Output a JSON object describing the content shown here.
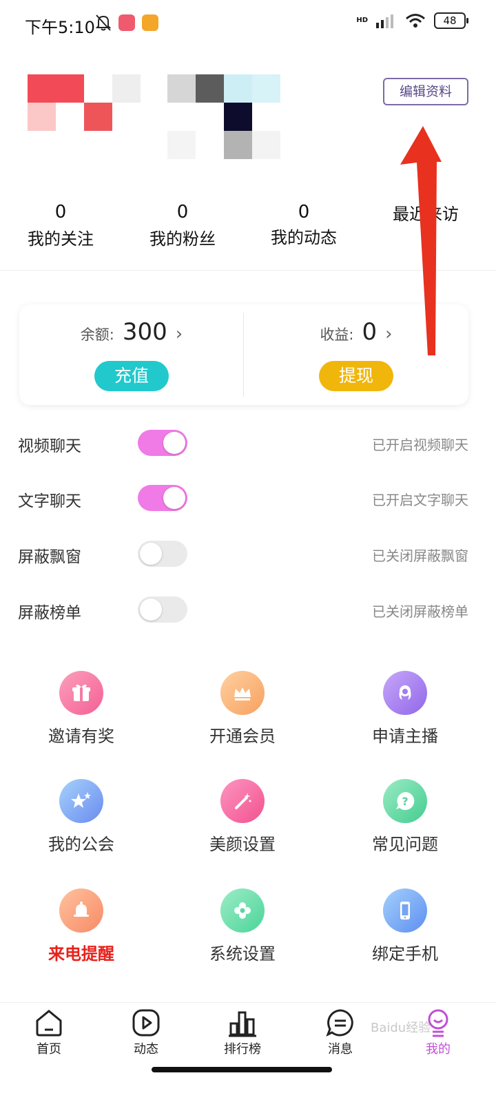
{
  "status_bar": {
    "time": "下午5:10",
    "hd": "HD",
    "battery": "48"
  },
  "profile": {
    "edit_label": "编辑资料"
  },
  "stats": [
    {
      "value": "0",
      "label": "我的关注"
    },
    {
      "value": "0",
      "label": "我的粉丝"
    },
    {
      "value": "0",
      "label": "我的动态"
    },
    {
      "value": "",
      "label": "最近来访"
    }
  ],
  "wallet": {
    "balance_label": "余额:",
    "balance_value": "300",
    "recharge_label": "充值",
    "earnings_label": "收益:",
    "earnings_value": "0",
    "withdraw_label": "提现"
  },
  "toggles": [
    {
      "label": "视频聊天",
      "on": true,
      "status": "已开启视频聊天"
    },
    {
      "label": "文字聊天",
      "on": true,
      "status": "已开启文字聊天"
    },
    {
      "label": "屏蔽飘窗",
      "on": false,
      "status": "已关闭屏蔽飘窗"
    },
    {
      "label": "屏蔽榜单",
      "on": false,
      "status": "已关闭屏蔽榜单"
    }
  ],
  "menu": [
    {
      "label": "邀请有奖",
      "icon": "gift-icon"
    },
    {
      "label": "开通会员",
      "icon": "crown-icon"
    },
    {
      "label": "申请主播",
      "icon": "anchor-avatar-icon"
    },
    {
      "label": "我的公会",
      "icon": "stars-icon"
    },
    {
      "label": "美颜设置",
      "icon": "magic-wand-icon"
    },
    {
      "label": "常见问题",
      "icon": "question-icon"
    },
    {
      "label": "来电提醒",
      "icon": "bell-icon"
    },
    {
      "label": "系统设置",
      "icon": "gear-icon"
    },
    {
      "label": "绑定手机",
      "icon": "phone-icon"
    }
  ],
  "tabs": [
    {
      "label": "首页",
      "icon": "home-icon"
    },
    {
      "label": "动态",
      "icon": "play-icon"
    },
    {
      "label": "排行榜",
      "icon": "ranking-icon"
    },
    {
      "label": "消息",
      "icon": "message-icon"
    },
    {
      "label": "我的",
      "icon": "profile-icon"
    }
  ],
  "watermark": "Baidu经验",
  "colors": {
    "accent_pink": "#f07ae6",
    "recharge_cyan": "#21c9cc",
    "withdraw_yellow": "#f1b60c",
    "edit_border": "#7b6aa8",
    "alert_red": "#e8211a",
    "arrow_red": "#e8311f"
  }
}
